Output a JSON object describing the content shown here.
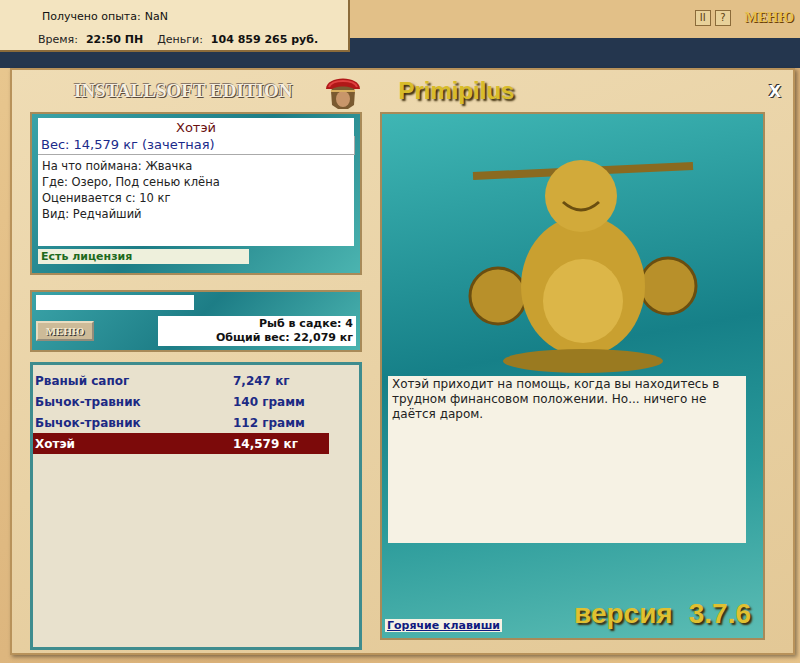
{
  "status": {
    "experience_label": "Получено опыта:",
    "experience": "NaN",
    "time_label": "Время:",
    "time": "22:50 ПН",
    "money_label": "Деньги:",
    "money": "104 859 265 руб."
  },
  "toolbar": {
    "pause": "II",
    "help": "?",
    "menu": "МЕНЮ"
  },
  "window": {
    "logo": "INSTALLSOFT EDITION",
    "title": "Primipilus",
    "close": "X"
  },
  "catch": {
    "name": "Хотэй",
    "weight": "Вес: 14,579 кг (зачетная)",
    "details": [
      "На что поймана: Жвачка",
      "Где: Озеро, Под сенью клёна",
      "Оценивается с: 10 кг",
      "Вид: Редчайший"
    ],
    "license": "Есть лицензия"
  },
  "menu_button": "МЕНЮ",
  "keepnet": {
    "count": "Рыб в садке: 4",
    "total": "Общий вес: 22,079 кг"
  },
  "fish_list": [
    {
      "name": "Рваный сапог",
      "weight": "7,247 кг",
      "selected": false
    },
    {
      "name": "Бычок-травник",
      "weight": "140 грамм",
      "selected": false
    },
    {
      "name": "Бычок-травник",
      "weight": "112 грамм",
      "selected": false
    },
    {
      "name": "Хотэй",
      "weight": "14,579 кг",
      "selected": true
    }
  ],
  "description": "Хотэй приходит на помощь, когда вы находитесь в трудном финансовом положении. Но... ничего не даётся даром.",
  "hotkeys": "Горячие клавиши",
  "version": {
    "label": "версия",
    "number": "3.7.6"
  }
}
